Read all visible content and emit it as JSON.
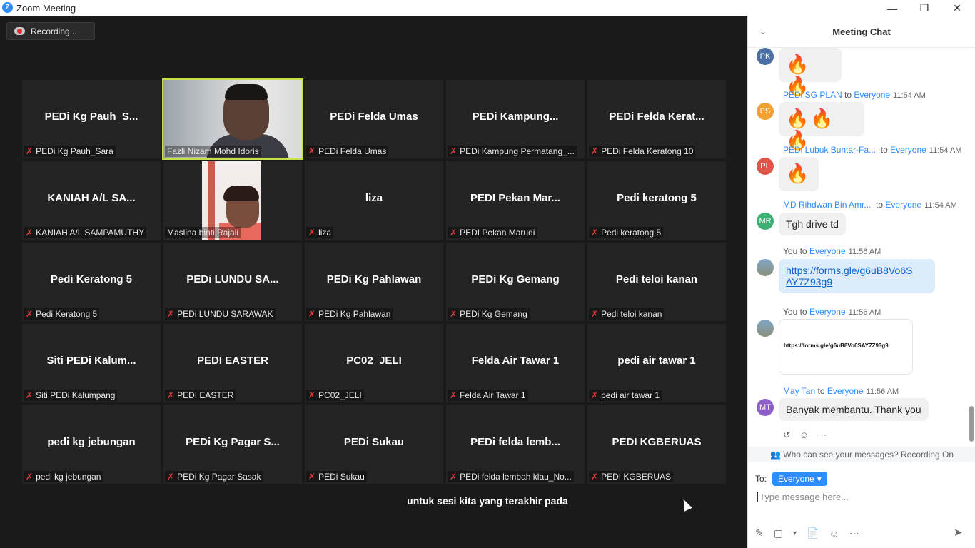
{
  "window": {
    "title": "Zoom Meeting",
    "app_icon": "Z",
    "controls": [
      "—",
      "❐",
      "✕"
    ]
  },
  "recording": {
    "label": "Recording..."
  },
  "tiles": [
    {
      "big": "PEDi Kg Pauh_S...",
      "name": "PEDi Kg Pauh_Sara"
    },
    {
      "big": "",
      "name": "Fazli Nizam Mohd Idoris",
      "video": true,
      "active": true
    },
    {
      "big": "PEDi Felda Umas",
      "name": "PEDi Felda Umas"
    },
    {
      "big": "PEDi Kampung...",
      "name": "PEDi Kampung Permatang_..."
    },
    {
      "big": "PEDi Felda Kerat...",
      "name": "PEDi Felda Keratong 10"
    },
    {
      "big": "KANIAH A/L SA...",
      "name": "KANIAH A/L SAMPAMUTHY"
    },
    {
      "big": "",
      "name": "Maslina binti Rajali",
      "video": true
    },
    {
      "big": "liza",
      "name": "liza"
    },
    {
      "big": "PEDI Pekan Mar...",
      "name": "PEDI Pekan Marudi"
    },
    {
      "big": "Pedi keratong 5",
      "name": "Pedi keratong 5"
    },
    {
      "big": "Pedi Keratong 5",
      "name": "Pedi Keratong 5"
    },
    {
      "big": "PEDi LUNDU SA...",
      "name": "PEDi LUNDU SARAWAK"
    },
    {
      "big": "PEDi Kg Pahlawan",
      "name": "PEDi Kg Pahlawan"
    },
    {
      "big": "PEDi Kg Gemang",
      "name": "PEDi Kg Gemang"
    },
    {
      "big": "Pedi teloi kanan",
      "name": "Pedi teloi kanan"
    },
    {
      "big": "Siti PEDi Kalum...",
      "name": "Siti PEDi Kalumpang"
    },
    {
      "big": "PEDI EASTER",
      "name": "PEDI EASTER"
    },
    {
      "big": "PC02_JELI",
      "name": "PC02_JELI"
    },
    {
      "big": "Felda Air Tawar 1",
      "name": "Felda Air Tawar 1"
    },
    {
      "big": "pedi air tawar 1",
      "name": "pedi air tawar 1"
    },
    {
      "big": "pedi kg jebungan",
      "name": "pedi kg jebungan"
    },
    {
      "big": "PEDi Kg Pagar S...",
      "name": "PEDi Kg Pagar Sasak"
    },
    {
      "big": "PEDi Sukau",
      "name": "PEDi Sukau"
    },
    {
      "big": "PEDi felda lemb...",
      "name": "PEDi felda lembah klau_No..."
    },
    {
      "big": "PEDI KGBERUAS",
      "name": "PEDI KGBERUAS"
    }
  ],
  "caption": "untuk sesi kita yang terakhir pada",
  "chat": {
    "title": "Meeting Chat",
    "messages": [
      {
        "initials": "PK",
        "avatar_color": "#4a6fa5",
        "content": "🔥🔥"
      },
      {
        "initials": "PS",
        "avatar_color": "#f0a030",
        "from": "PEDi SG PLAN",
        "to": "to",
        "everyone": "Everyone",
        "time": "11:54 AM",
        "content": "🔥🔥🔥"
      },
      {
        "initials": "PL",
        "avatar_color": "#e0564a",
        "from": "PEDi Lubuk Buntar-Fa...",
        "to": "to",
        "everyone": "Everyone",
        "time": "11:54 AM",
        "content": "🔥"
      },
      {
        "initials": "MR",
        "avatar_color": "#3bb273",
        "from": "MD Rihdwan Bin Amr...",
        "to": "to",
        "everyone": "Everyone",
        "time": "11:54 AM",
        "content": "Tgh drive td"
      },
      {
        "from": "You",
        "to": "to",
        "everyone": "Everyone",
        "time": "11:56 AM",
        "link_line1": "https://forms.gle/g6uB8Vo6S",
        "link_line2": "AY7Z93g9"
      },
      {
        "from": "You",
        "to": "to",
        "everyone": "Everyone",
        "time": "11:56 AM",
        "image_text": "https://forms.gle/g6uB8Vo6SAY7Z93g9"
      },
      {
        "initials": "MT",
        "avatar_color": "#8e5fc9",
        "from": "May Tan",
        "to": "to",
        "everyone": "Everyone",
        "time": "11:56 AM",
        "content": "Banyak membantu. Thank you"
      }
    ],
    "privacy_notice": "Who can see your messages? Recording On",
    "to_label": "To:",
    "recipient": "Everyone",
    "input_placeholder": "Type message here..."
  }
}
